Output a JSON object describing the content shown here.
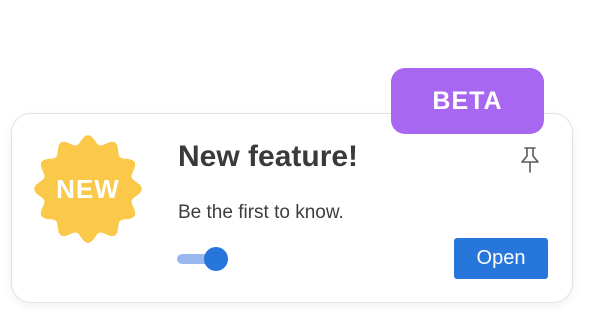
{
  "beta_badge": {
    "label": "BETA",
    "color": "#a867f1"
  },
  "new_badge": {
    "label": "NEW",
    "color": "#fbc94a",
    "icon": "starburst-badge-icon"
  },
  "card": {
    "title": "New feature!",
    "subtitle": "Be the first to know.",
    "pin_icon": "pin-icon"
  },
  "toggle": {
    "state": "on",
    "accent": "#2776dc"
  },
  "open_button": {
    "label": "Open",
    "color": "#2776dc"
  }
}
